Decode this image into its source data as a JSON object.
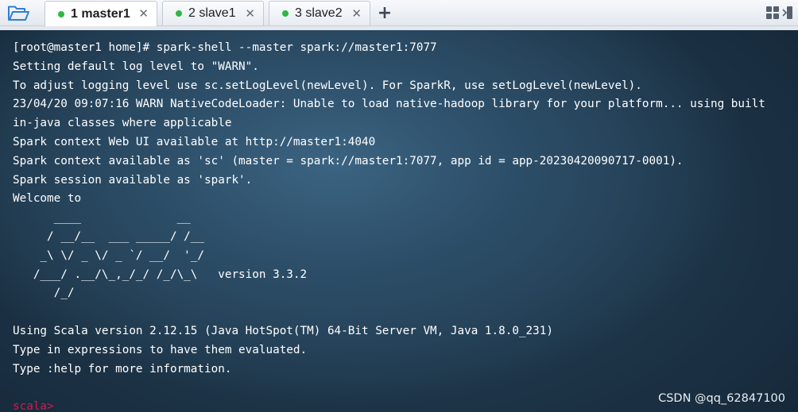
{
  "tabs": [
    {
      "label": "1 master1",
      "active": true,
      "status_color": "#2db843",
      "close": "✕"
    },
    {
      "label": "2 slave1",
      "active": false,
      "status_color": "#2db843",
      "close": "✕"
    },
    {
      "label": "3 slave2",
      "active": false,
      "status_color": "#2db843",
      "close": "✕"
    }
  ],
  "toolbar": {
    "add_tab_label": "+",
    "folder_icon": "folder-open-icon",
    "layout_icon": "grid-layout-icon"
  },
  "terminal": {
    "lines": [
      "[root@master1 home]# spark-shell --master spark://master1:7077",
      "Setting default log level to \"WARN\".",
      "To adjust logging level use sc.setLogLevel(newLevel). For SparkR, use setLogLevel(newLevel).",
      "23/04/20 09:07:16 WARN NativeCodeLoader: Unable to load native-hadoop library for your platform... using built",
      "in-java classes where applicable",
      "Spark context Web UI available at http://master1:4040",
      "Spark context available as 'sc' (master = spark://master1:7077, app id = app-20230420090717-0001).",
      "Spark session available as 'spark'.",
      "Welcome to",
      "      ____              __",
      "     / __/__  ___ _____/ /__",
      "    _\\ \\/ _ \\/ _ `/ __/  '_/",
      "   /___/ .__/\\_,_/_/ /_/\\_\\   version 3.3.2",
      "      /_/",
      "",
      "Using Scala version 2.12.15 (Java HotSpot(TM) 64-Bit Server VM, Java 1.8.0_231)",
      "Type in expressions to have them evaluated.",
      "Type :help for more information.",
      ""
    ],
    "prompt": "scala>",
    "text_color": "#ffffff",
    "prompt_color": "#d4184f"
  },
  "watermark": "CSDN @qq_62847100",
  "colors": {
    "folder_icon": "#2f7fd3",
    "terminal_bg": "#1f3a50"
  }
}
